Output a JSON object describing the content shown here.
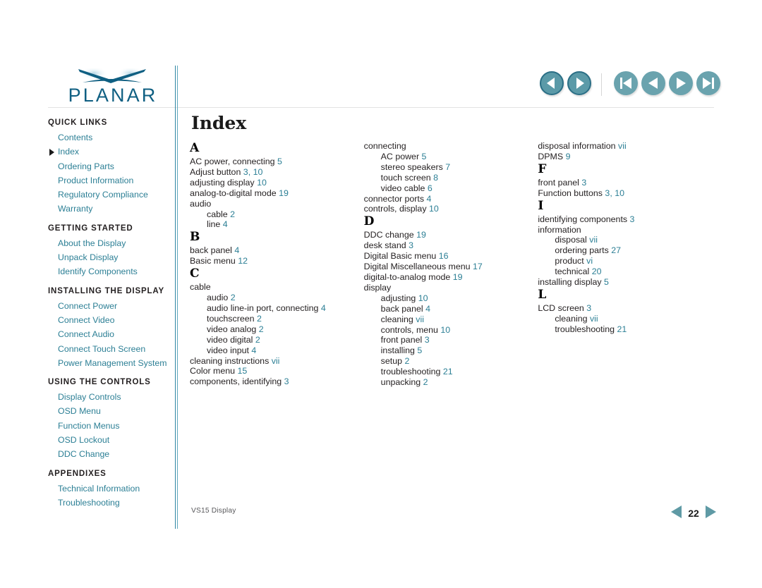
{
  "brand": {
    "name": "PLANAR",
    "logo_icon": "planar-swoosh-logo"
  },
  "header": {
    "rule_color": "#e2e2e2",
    "divider_color": "#2f86a3"
  },
  "topnav": {
    "buttons": [
      {
        "name": "back-button",
        "icon": "arrow-left-icon"
      },
      {
        "name": "forward-button",
        "icon": "arrow-right-icon"
      },
      {
        "name": "first-page-button",
        "icon": "skip-to-start-icon"
      },
      {
        "name": "previous-page-button",
        "icon": "triangle-left-icon"
      },
      {
        "name": "next-page-button",
        "icon": "triangle-right-icon"
      },
      {
        "name": "last-page-button",
        "icon": "skip-to-end-icon"
      }
    ],
    "button_color": "#5b9aa8",
    "button_border": "#2b6f86"
  },
  "sidebar": {
    "groups": [
      {
        "heading": "QUICK LINKS",
        "links": [
          {
            "label": "Contents",
            "current": false
          },
          {
            "label": "Index",
            "current": true
          },
          {
            "label": "Ordering Parts",
            "current": false
          },
          {
            "label": "Product Information",
            "current": false
          },
          {
            "label": "Regulatory Compliance",
            "current": false
          },
          {
            "label": "Warranty",
            "current": false
          }
        ]
      },
      {
        "heading": "GETTING STARTED",
        "links": [
          {
            "label": "About the Display",
            "current": false
          },
          {
            "label": "Unpack Display",
            "current": false
          },
          {
            "label": "Identify Components",
            "current": false
          }
        ]
      },
      {
        "heading": "INSTALLING THE DISPLAY",
        "links": [
          {
            "label": "Connect Power",
            "current": false
          },
          {
            "label": "Connect Video",
            "current": false
          },
          {
            "label": "Connect Audio",
            "current": false
          },
          {
            "label": "Connect Touch Screen",
            "current": false
          },
          {
            "label": "Power Management System",
            "current": false
          }
        ]
      },
      {
        "heading": "USING THE CONTROLS",
        "links": [
          {
            "label": "Display Controls",
            "current": false
          },
          {
            "label": "OSD Menu",
            "current": false
          },
          {
            "label": "Function Menus",
            "current": false
          },
          {
            "label": "OSD Lockout",
            "current": false
          },
          {
            "label": "DDC Change",
            "current": false
          }
        ]
      },
      {
        "heading": "APPENDIXES",
        "links": [
          {
            "label": "Technical Information",
            "current": false
          },
          {
            "label": "Troubleshooting",
            "current": false
          }
        ]
      }
    ],
    "link_color": "#2c7f95"
  },
  "main": {
    "title": "Index",
    "columns": [
      {
        "blocks": [
          {
            "letter": "A",
            "entries": [
              {
                "text": "AC power, connecting",
                "page": "5",
                "sub": false
              },
              {
                "text": "Adjust button",
                "page": "3,  10",
                "sub": false
              },
              {
                "text": "adjusting display",
                "page": "10",
                "sub": false
              },
              {
                "text": "analog-to-digital mode",
                "page": "19",
                "sub": false
              },
              {
                "text": "audio",
                "page": "",
                "sub": false
              },
              {
                "text": "cable",
                "page": "2",
                "sub": true
              },
              {
                "text": "line",
                "page": "4",
                "sub": true
              }
            ]
          },
          {
            "letter": "B",
            "entries": [
              {
                "text": "back panel",
                "page": "4",
                "sub": false
              },
              {
                "text": "Basic menu",
                "page": "12",
                "sub": false
              }
            ]
          },
          {
            "letter": "C",
            "entries": [
              {
                "text": "cable",
                "page": "",
                "sub": false
              },
              {
                "text": "audio",
                "page": "2",
                "sub": true
              },
              {
                "text": "audio line-in port, connecting",
                "page": "4",
                "sub": true
              },
              {
                "text": "touchscreen",
                "page": "2",
                "sub": true
              },
              {
                "text": "video analog",
                "page": "2",
                "sub": true
              },
              {
                "text": "video digital",
                "page": "2",
                "sub": true
              },
              {
                "text": "video input",
                "page": "4",
                "sub": true
              },
              {
                "text": "cleaning instructions",
                "page": "vii",
                "sub": false
              },
              {
                "text": "Color menu",
                "page": "15",
                "sub": false
              },
              {
                "text": "components, identifying",
                "page": "3",
                "sub": false
              }
            ]
          }
        ]
      },
      {
        "blocks": [
          {
            "letter": "",
            "entries": [
              {
                "text": "connecting",
                "page": "",
                "sub": false
              },
              {
                "text": "AC power",
                "page": "5",
                "sub": true
              },
              {
                "text": "stereo speakers",
                "page": "7",
                "sub": true
              },
              {
                "text": "touch screen",
                "page": "8",
                "sub": true
              },
              {
                "text": "video cable",
                "page": "6",
                "sub": true
              },
              {
                "text": "connector ports",
                "page": "4",
                "sub": false
              },
              {
                "text": "controls, display",
                "page": "10",
                "sub": false
              }
            ]
          },
          {
            "letter": "D",
            "entries": [
              {
                "text": "DDC change",
                "page": "19",
                "sub": false
              },
              {
                "text": "desk stand",
                "page": "3",
                "sub": false
              },
              {
                "text": "Digital Basic menu",
                "page": "16",
                "sub": false
              },
              {
                "text": "Digital Miscellaneous menu",
                "page": "17",
                "sub": false
              },
              {
                "text": "digital-to-analog mode",
                "page": "19",
                "sub": false
              },
              {
                "text": "display",
                "page": "",
                "sub": false
              },
              {
                "text": "adjusting",
                "page": "10",
                "sub": true
              },
              {
                "text": "back panel",
                "page": "4",
                "sub": true
              },
              {
                "text": "cleaning",
                "page": "vii",
                "sub": true
              },
              {
                "text": "controls, menu",
                "page": "10",
                "sub": true
              },
              {
                "text": "front panel",
                "page": "3",
                "sub": true
              },
              {
                "text": "installing",
                "page": "5",
                "sub": true
              },
              {
                "text": "setup",
                "page": "2",
                "sub": true
              },
              {
                "text": "troubleshooting",
                "page": "21",
                "sub": true
              },
              {
                "text": "unpacking",
                "page": "2",
                "sub": true
              }
            ]
          }
        ]
      },
      {
        "blocks": [
          {
            "letter": "",
            "entries": [
              {
                "text": "disposal information",
                "page": "vii",
                "sub": false
              },
              {
                "text": "DPMS",
                "page": "9",
                "sub": false
              }
            ]
          },
          {
            "letter": "F",
            "entries": [
              {
                "text": "front panel",
                "page": "3",
                "sub": false
              },
              {
                "text": "Function buttons",
                "page": "3,  10",
                "sub": false
              }
            ]
          },
          {
            "letter": "I",
            "entries": [
              {
                "text": "identifying components",
                "page": "3",
                "sub": false
              },
              {
                "text": "information",
                "page": "",
                "sub": false
              },
              {
                "text": "disposal",
                "page": "vii",
                "sub": true
              },
              {
                "text": "ordering parts",
                "page": "27",
                "sub": true
              },
              {
                "text": "product",
                "page": "vi",
                "sub": true
              },
              {
                "text": "technical",
                "page": "20",
                "sub": true
              },
              {
                "text": "installing display",
                "page": "5",
                "sub": false
              }
            ]
          },
          {
            "letter": "L",
            "entries": [
              {
                "text": "LCD screen",
                "page": "3",
                "sub": false
              },
              {
                "text": "cleaning",
                "page": "vii",
                "sub": true
              },
              {
                "text": "troubleshooting",
                "page": "21",
                "sub": true
              }
            ]
          }
        ]
      }
    ],
    "page_number_color": "#2c7f95"
  },
  "footer": {
    "document_label": "VS15 Display",
    "page_number": "22",
    "prev_icon": "triangle-left-icon",
    "next_icon": "triangle-right-icon"
  }
}
